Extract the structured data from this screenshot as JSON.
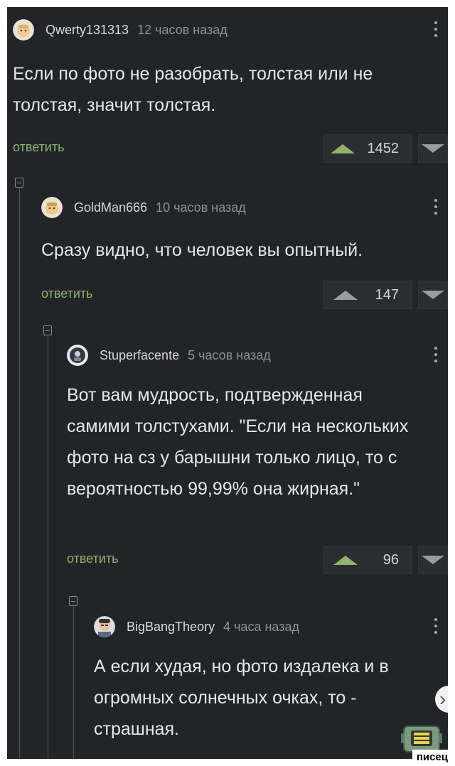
{
  "comments": [
    {
      "username": "Qwerty131313",
      "timestamp": "12 часов назад",
      "text": "Если по фото не разобрать, толстая или не толстая, значит толстая.",
      "reply_label": "ответить",
      "score": "1452",
      "upvoted": true
    },
    {
      "username": "GoldMan666",
      "timestamp": "10 часов назад",
      "text": "Сразу видно, что человек вы опытный.",
      "reply_label": "ответить",
      "score": "147",
      "upvoted": false
    },
    {
      "username": "Stuperfacente",
      "timestamp": "5 часов назад",
      "text": "Вот вам мудрость, подтвержденная самими толстухами. \"Если на нескольких фото на сз у барышни только лицо, то с вероятностью 99,99% она жирная.\"",
      "reply_label": "ответить",
      "score": "96",
      "upvoted": true
    },
    {
      "username": "BigBangTheory",
      "timestamp": "4 часа назад",
      "text": "А если худая, но фото издалека и в огромных солнечных очках, то - страшная."
    }
  ],
  "icons": {
    "collapse": "minus-square-icon",
    "menu": "vertical-dots-icon",
    "upvote": "triangle-up-icon",
    "downvote": "triangle-down-icon",
    "scroll": "chevron-right-icon",
    "sticker": "robot-sticker-icon"
  },
  "colors": {
    "background": "#232428",
    "text": "#e5e6ea",
    "meta": "#8e9096",
    "accent_green": "#8fb36b",
    "thread_line": "#55575c"
  },
  "watermark": "писец"
}
